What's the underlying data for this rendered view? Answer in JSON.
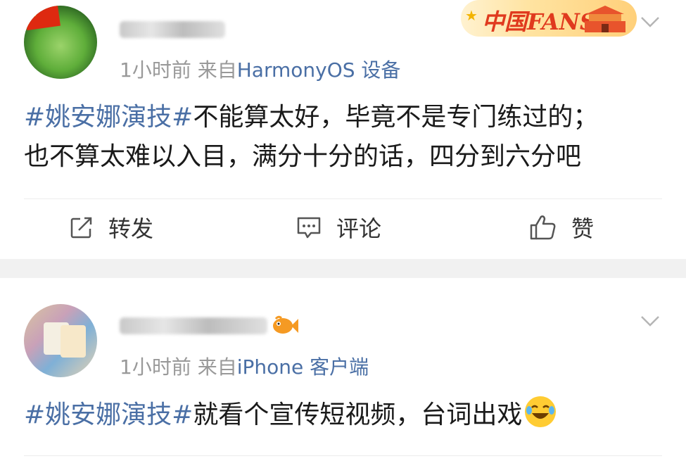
{
  "posts": [
    {
      "time": "1小时前",
      "from_prefix": "来自",
      "source": "HarmonyOS 设备",
      "badge": "中国FANS",
      "hashtag": "#姚安娜演技#",
      "line1_text": "不能算太好，毕竟不是专门练过的；",
      "line2_text": "也不算太难以入目，满分十分的话，四分到六分吧",
      "actions": {
        "repost": "转发",
        "comment": "评论",
        "like": "赞"
      }
    },
    {
      "time": "1小时前",
      "from_prefix": "来自",
      "source": "iPhone 客户端",
      "hashtag": "#姚安娜演技#",
      "line1_text": "就看个宣传短视频，台词出戏",
      "emoji_icon": "laughing-tears-emoji"
    }
  ],
  "colors": {
    "link_blue": "#4a6fa5",
    "meta_gray": "#999999",
    "separator": "#f1f1f1",
    "badge_red": "#e03a1e"
  }
}
